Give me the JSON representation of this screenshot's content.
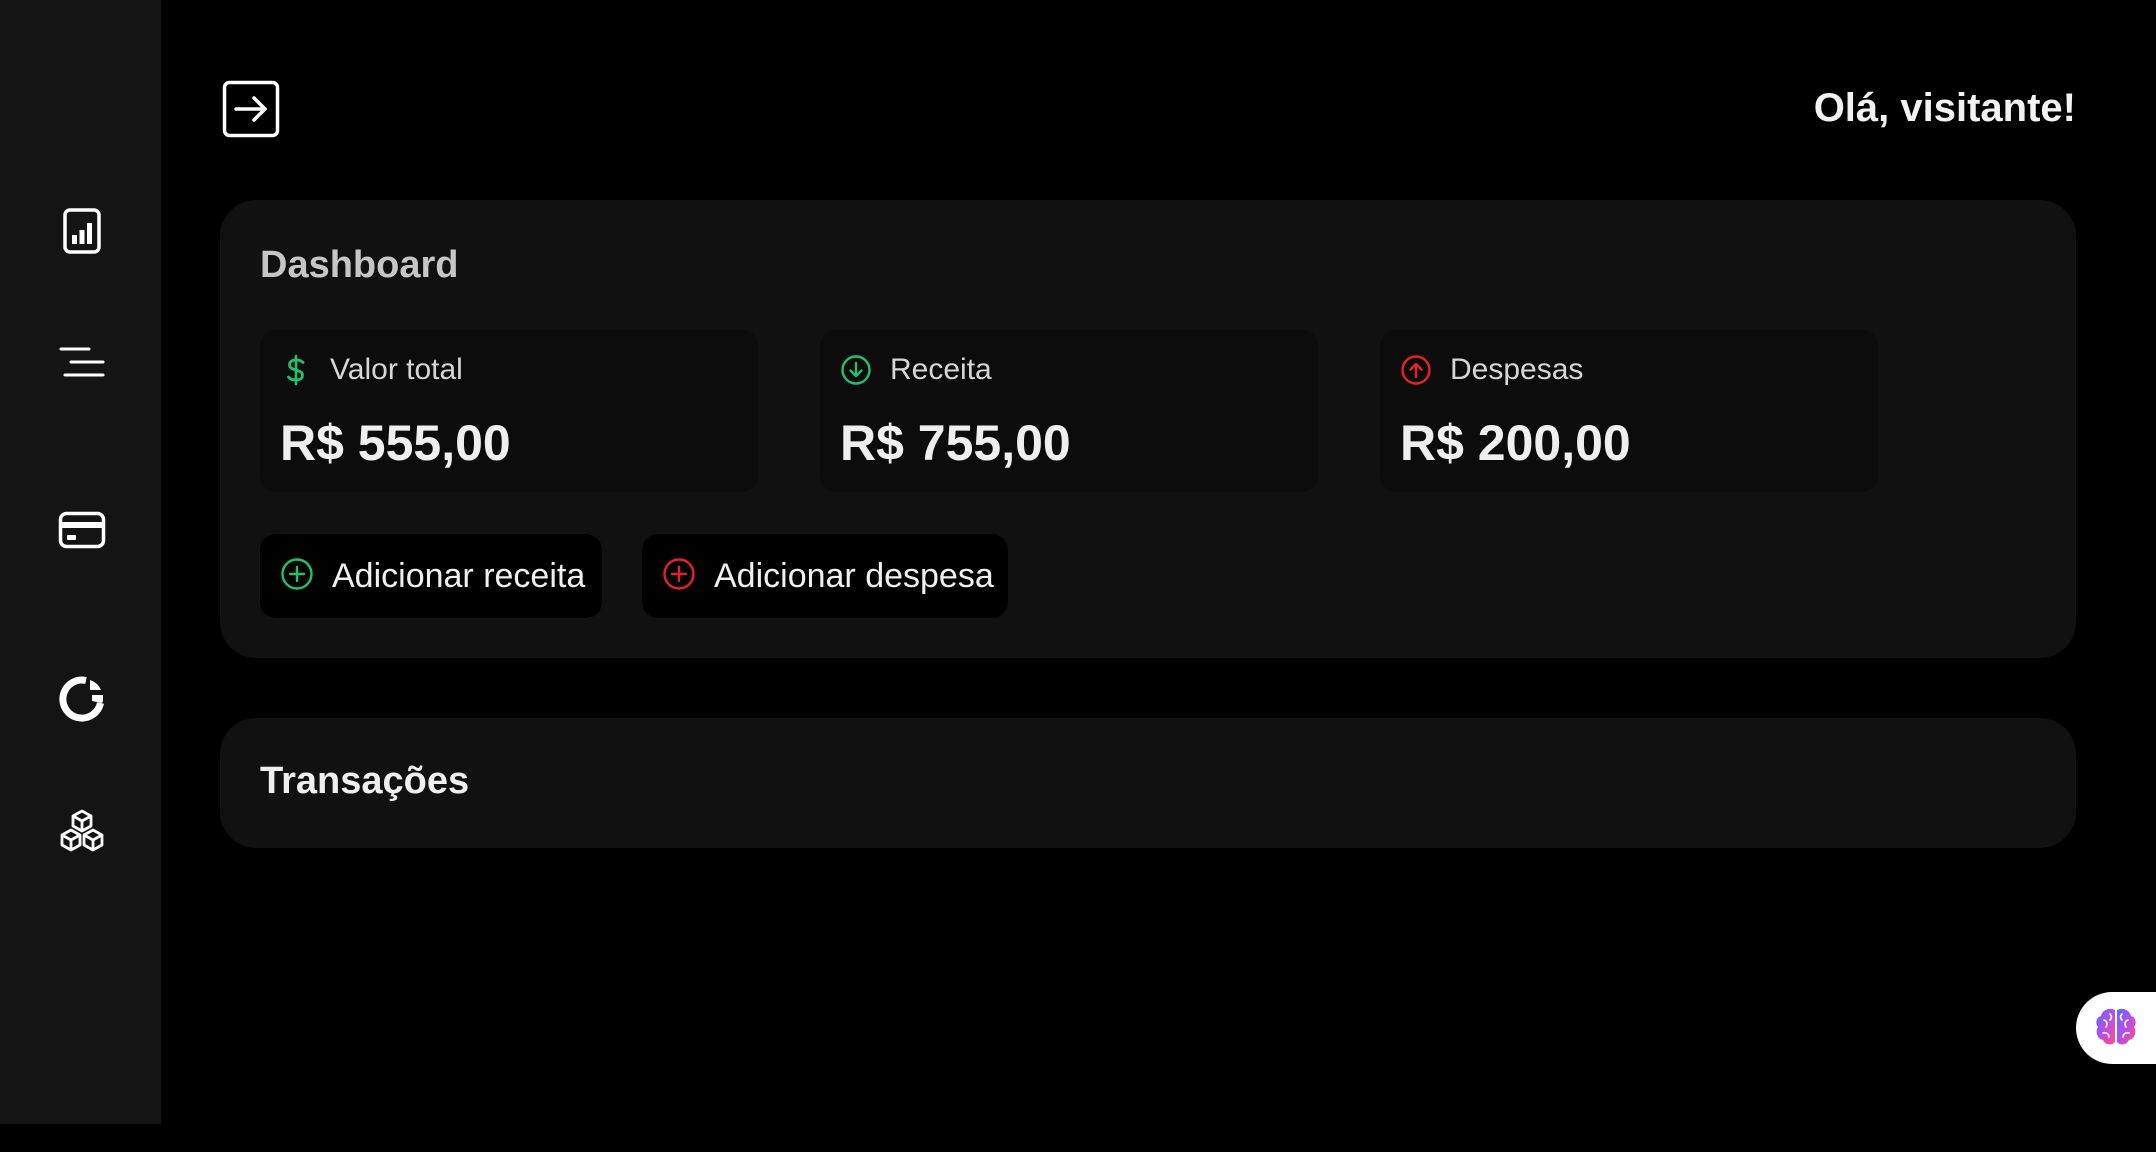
{
  "header": {
    "greeting": "Olá, visitante!"
  },
  "sidebar": {
    "items": [
      {
        "icon": "chart-icon",
        "label": ""
      },
      {
        "icon": "list-icon",
        "label": ""
      },
      {
        "icon": "card-icon",
        "label": ""
      },
      {
        "icon": "pie-icon",
        "label": ""
      },
      {
        "icon": "cubes-icon",
        "label": ""
      }
    ]
  },
  "dashboard": {
    "title": "Dashboard",
    "cards": [
      {
        "label": "Valor total",
        "value": "R$ 555,00",
        "icon": "dollar-icon",
        "color": "#21c16b"
      },
      {
        "label": "Receita",
        "value": "R$ 755,00",
        "icon": "arrow-down-circle-icon",
        "color": "#21c16b"
      },
      {
        "label": "Despesas",
        "value": "R$ 200,00",
        "icon": "arrow-up-circle-icon",
        "color": "#e5212a"
      }
    ],
    "actions": {
      "add_income": "Adicionar receita",
      "add_expense": "Adicionar despesa"
    }
  },
  "transactions": {
    "title": "Transações"
  },
  "colors": {
    "income": "#21c16b",
    "expense": "#e5212a",
    "panel": "#111111",
    "sidebar": "#141414"
  }
}
